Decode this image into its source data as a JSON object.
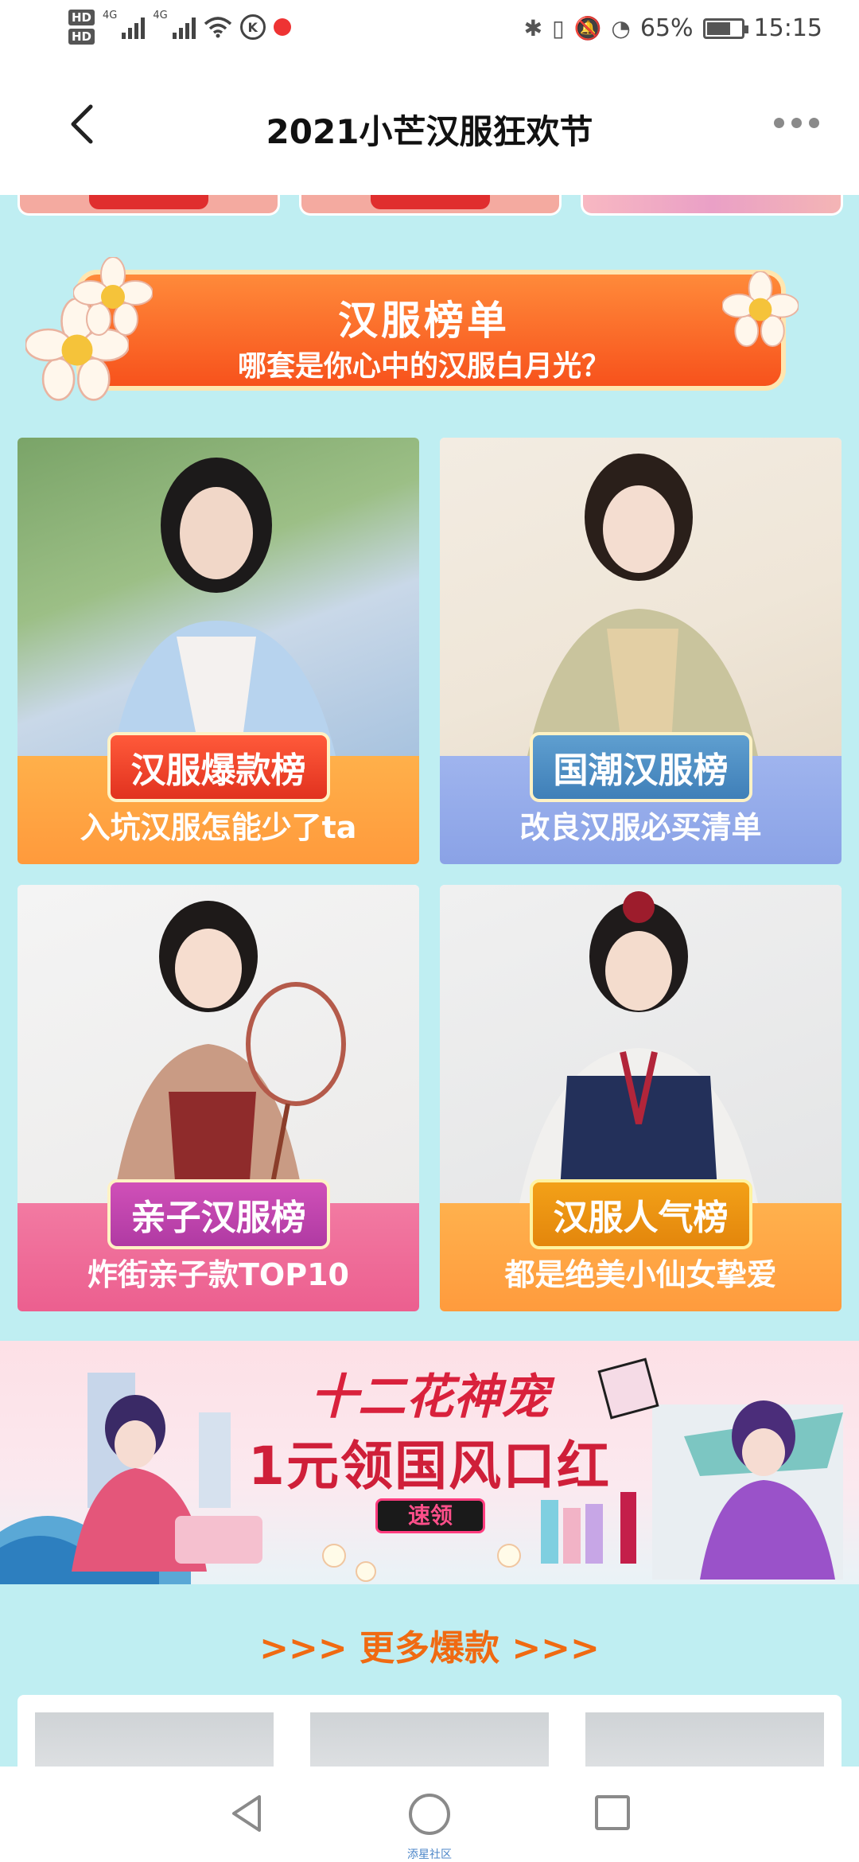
{
  "status_bar": {
    "hd1": "HD",
    "hd2": "HD",
    "gen1": "4G",
    "gen2": "4G",
    "battery": "65%",
    "time": "15:15",
    "k_icon": "K"
  },
  "nav": {
    "title": "2021小芒汉服狂欢节"
  },
  "banner": {
    "title": "汉服榜单",
    "subtitle": "哪套是你心中的汉服白月光？"
  },
  "cards": [
    {
      "badge": "汉服爆款榜",
      "subtitle": "入坑汉服怎能少了ta"
    },
    {
      "badge": "国潮汉服榜",
      "subtitle": "改良汉服必买清单"
    },
    {
      "badge": "亲子汉服榜",
      "subtitle": "炸街亲子款TOP10"
    },
    {
      "badge": "汉服人气榜",
      "subtitle": "都是绝美小仙女挚爱"
    }
  ],
  "promo": {
    "line1": "十二花神宠",
    "line2": "1元领国风口红",
    "button": "速领"
  },
  "more": {
    "title": ">>>  更多爆款  >>>"
  },
  "system_nav": {
    "label": "添星社区"
  },
  "colors": {
    "accent": "#f06a12",
    "background": "#bfeef2"
  }
}
